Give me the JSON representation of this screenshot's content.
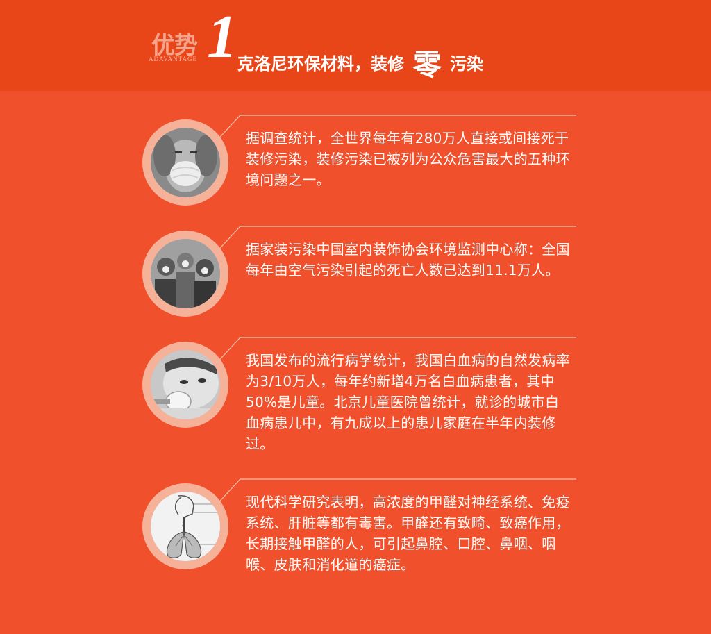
{
  "header": {
    "brand_cn": "优势",
    "brand_en": "ADAVANTAGE",
    "brand_number": "1",
    "headline_before": "克洛尼环保材料，装修",
    "headline_emphasis": "零",
    "headline_after": "污染"
  },
  "items": [
    {
      "icon": "masked-person-photo",
      "text": "据调查统计，全世界每年有280万人直接或间接死于装修污染，装修污染已被列为公众危害最大的五种环境问题之一。"
    },
    {
      "icon": "crowd-with-masks-photo",
      "text": "据家装污染中国室内装饰协会环境监测中心称：全国每年由空气污染引起的死亡人数已达到11.1万人。"
    },
    {
      "icon": "baby-with-oxygen-mask-photo",
      "text": "我国发布的流行病学统计，我国白血病的自然发病率为3/10万人，每年约新增4万名白血病患者，其中50%是儿童。北京儿童医院曾统计，就诊的城市白血病患儿中，有九成以上的患儿家庭在半年内装修过。"
    },
    {
      "icon": "respiratory-system-diagram",
      "text": "现代科学研究表明，高浓度的甲醛对神经系统、免疫系统、肝脏等都有毒害。甲醛还有致畸、致癌作用，长期接触甲醛的人，可引起鼻腔、口腔、鼻咽、咽喉、皮肤和消化道的癌症。"
    }
  ],
  "colors": {
    "header_bg": "#e84619",
    "page_bg": "#f0512c",
    "ring": "#f6b299",
    "text": "#ffffff"
  }
}
